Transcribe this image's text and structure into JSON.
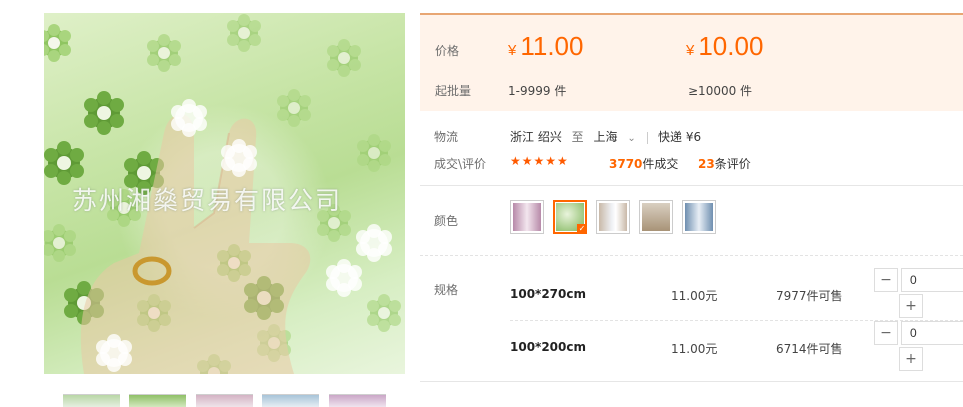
{
  "gallery": {
    "watermark": "苏州湘燊贸易有限公司",
    "thumbnails": [
      "thumb-1",
      "thumb-2",
      "thumb-3",
      "thumb-4",
      "thumb-5"
    ]
  },
  "price_panel": {
    "price_label": "价格",
    "moq_label": "起批量",
    "tiers": [
      {
        "currency": "¥",
        "price": "11.00",
        "range": "1-9999 件"
      },
      {
        "currency": "¥",
        "price": "10.00",
        "range": "≥10000 件"
      }
    ]
  },
  "logistics": {
    "label": "物流",
    "from": "浙江 绍兴",
    "to_word": "至",
    "to": "上海",
    "shipping": "快递 ¥6"
  },
  "reviews": {
    "label": "成交\\评价",
    "stars": "★★★★★",
    "sold_count": "3770",
    "sold_suffix": "件成交",
    "review_count": "23",
    "review_suffix": "条评价"
  },
  "colors": {
    "label": "颜色",
    "swatches": [
      "pink-curtain",
      "green-flower-curtain",
      "white-curtain",
      "beige-curtain",
      "blue-curtain"
    ],
    "selected_index": 1
  },
  "specs": {
    "label": "规格",
    "rows": [
      {
        "name": "100*270cm",
        "price": "11.00元",
        "stock": "7977件可售",
        "qty": "0"
      },
      {
        "name": "100*200cm",
        "price": "11.00元",
        "stock": "6714件可售",
        "qty": "0"
      }
    ],
    "minus": "−",
    "plus": "+"
  },
  "colors_palette": {
    "accent": "#ff6600",
    "panel_bg": "#fff3ea",
    "panel_border": "#e8a673"
  }
}
